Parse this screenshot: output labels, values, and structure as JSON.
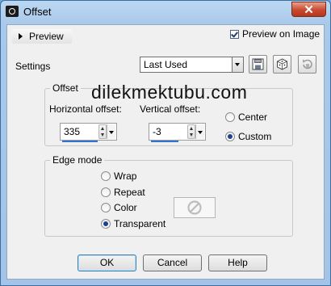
{
  "window": {
    "title": "Offset",
    "close_label": "✕"
  },
  "preview": {
    "toggle_label": "Preview",
    "preview_on_image_label": "Preview on Image",
    "preview_on_image_checked": true
  },
  "settings": {
    "label": "Settings",
    "preset_value": "Last Used"
  },
  "icons": [
    "save-preset-icon",
    "randomize-dice-icon",
    "reset-icon",
    "triangle-right-icon",
    "no-color-icon"
  ],
  "offset_group": {
    "title": "Offset",
    "horizontal_label": "Horizontal offset:",
    "horizontal_value": "335",
    "vertical_label": "Vertical offset:",
    "vertical_value": "-3",
    "center_label": "Center",
    "custom_label": "Custom",
    "selected": "Custom"
  },
  "edge_group": {
    "title": "Edge mode",
    "options": [
      "Wrap",
      "Repeat",
      "Color",
      "Transparent"
    ],
    "selected": "Transparent"
  },
  "buttons": {
    "ok": "OK",
    "cancel": "Cancel",
    "help": "Help"
  },
  "watermark": "dilekmektubu.com",
  "colors": {
    "title_bar": "#a9c9ea",
    "close_button": "#c74a30",
    "focus_accent": "#2f74d0",
    "dialog_bg": "#f0f0f0"
  }
}
